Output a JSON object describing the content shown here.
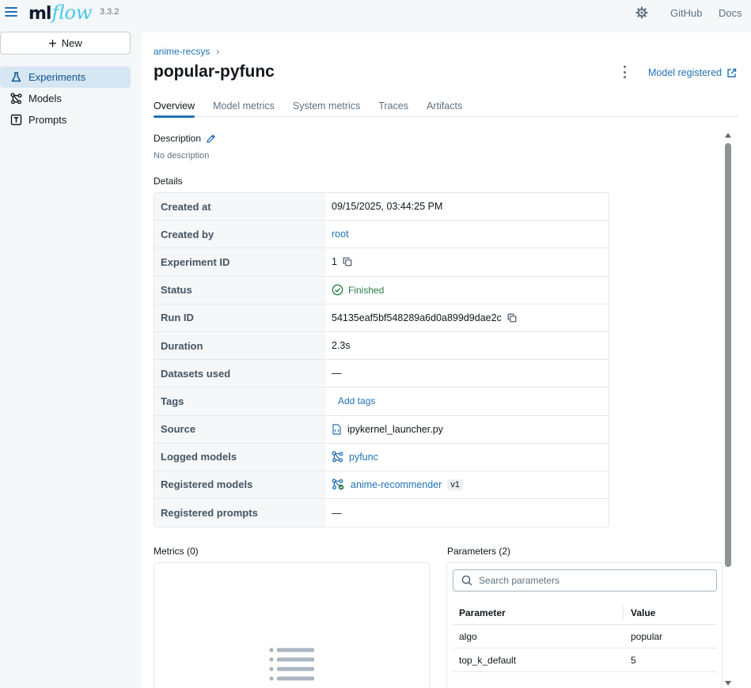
{
  "app": {
    "logo_ml": "ml",
    "logo_flow": "flow",
    "version": "3.3.2",
    "github_label": "GitHub",
    "docs_label": "Docs"
  },
  "sidebar": {
    "new_label": "New",
    "items": [
      {
        "label": "Experiments",
        "icon": "flask-icon",
        "active": true
      },
      {
        "label": "Models",
        "icon": "models-icon",
        "active": false
      },
      {
        "label": "Prompts",
        "icon": "prompt-icon",
        "active": false
      }
    ]
  },
  "header": {
    "breadcrumb": "anime-recsys",
    "breadcrumb_sep": "›",
    "title": "popular-pyfunc",
    "model_registered_label": "Model registered"
  },
  "tabs": [
    "Overview",
    "Model metrics",
    "System metrics",
    "Traces",
    "Artifacts"
  ],
  "overview": {
    "description_label": "Description",
    "description_text": "No description",
    "details_label": "Details",
    "details": {
      "created_at_label": "Created at",
      "created_at": "09/15/2025, 03:44:25 PM",
      "created_by_label": "Created by",
      "created_by": "root",
      "experiment_id_label": "Experiment ID",
      "experiment_id": "1",
      "status_label": "Status",
      "status": "Finished",
      "run_id_label": "Run ID",
      "run_id": "54135eaf5bf548289a6d0a899d9dae2c",
      "duration_label": "Duration",
      "duration": "2.3s",
      "datasets_label": "Datasets used",
      "datasets": "—",
      "tags_label": "Tags",
      "add_tags": "Add tags",
      "source_label": "Source",
      "source": "ipykernel_launcher.py",
      "logged_models_label": "Logged models",
      "logged_model": "pyfunc",
      "registered_models_label": "Registered models",
      "registered_model": "anime-recommender",
      "registered_model_version": "v1",
      "registered_prompts_label": "Registered prompts",
      "registered_prompts": "—"
    },
    "metrics_label": "Metrics (0)",
    "parameters_label": "Parameters (2)",
    "search_placeholder": "Search parameters",
    "param_headers": {
      "parameter": "Parameter",
      "value": "Value"
    },
    "params": [
      {
        "name": "algo",
        "value": "popular"
      },
      {
        "name": "top_k_default",
        "value": "5"
      }
    ]
  },
  "colors": {
    "accent": "#2272b4",
    "success": "#277c43",
    "sidebar_active_bg": "#d7e6f3"
  }
}
